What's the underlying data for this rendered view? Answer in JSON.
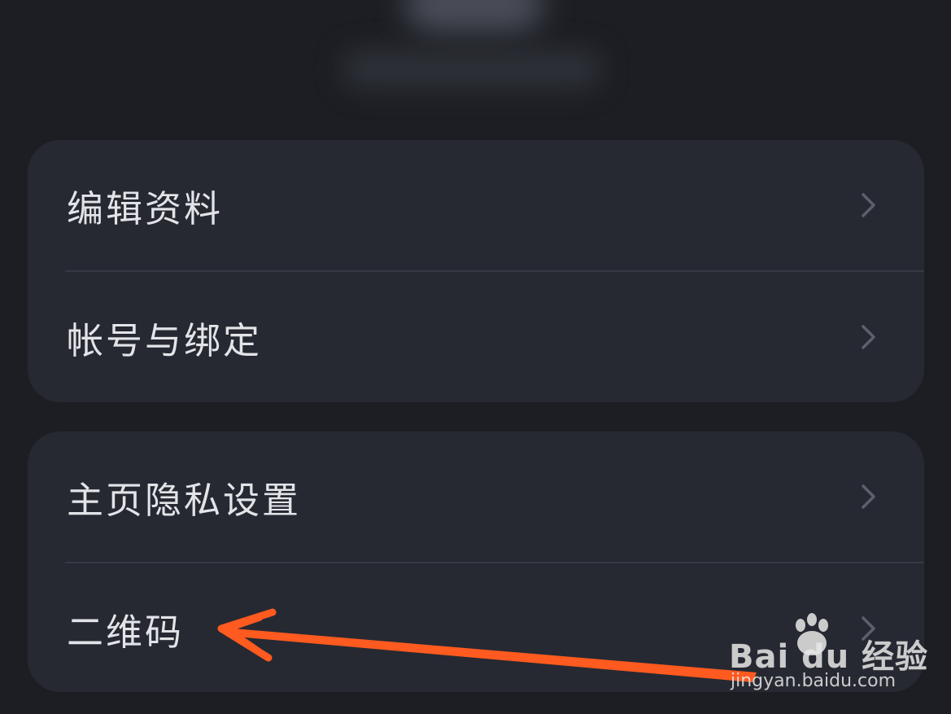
{
  "settings": {
    "group1": [
      {
        "label": "编辑资料"
      },
      {
        "label": "帐号与绑定"
      }
    ],
    "group2": [
      {
        "label": "主页隐私设置"
      },
      {
        "label": "二维码"
      }
    ]
  },
  "watermark": {
    "logo": "Bai du 经验",
    "url": "jingyan.baidu.com"
  },
  "colors": {
    "background": "#1c1e23",
    "card": "#262932",
    "text": "#e3e4e8",
    "arrow": "#ff5a1f"
  }
}
